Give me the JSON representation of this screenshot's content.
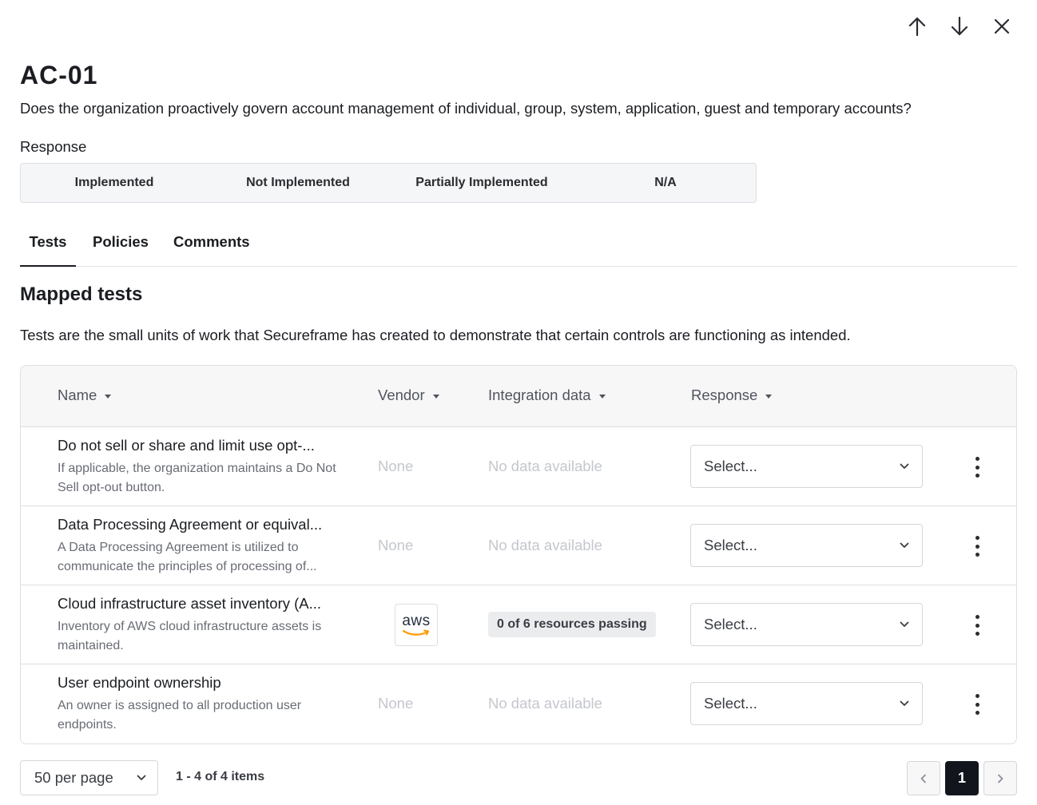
{
  "control": {
    "id": "AC-01",
    "question": "Does the organization proactively govern account management of individual, group, system, application, guest and temporary accounts?"
  },
  "response": {
    "label": "Response",
    "options": [
      "Implemented",
      "Not Implemented",
      "Partially Implemented",
      "N/A"
    ]
  },
  "tabs": [
    {
      "label": "Tests",
      "active": true
    },
    {
      "label": "Policies",
      "active": false
    },
    {
      "label": "Comments",
      "active": false
    }
  ],
  "mapped": {
    "title": "Mapped tests",
    "description": "Tests are the small units of work that Secureframe has created to demonstrate that certain controls are functioning as intended."
  },
  "table": {
    "columns": [
      "Name",
      "Vendor",
      "Integration data",
      "Response"
    ],
    "rows": [
      {
        "title": "Do not sell or share and limit use opt-...",
        "description": "If applicable, the organization maintains a Do Not Sell opt-out button.",
        "vendor": "None",
        "integration": "No data available",
        "response_placeholder": "Select..."
      },
      {
        "title": "Data Processing Agreement or equival...",
        "description": "A Data Processing Agreement is utilized to communicate the principles of processing of...",
        "vendor": "None",
        "integration": "No data available",
        "response_placeholder": "Select..."
      },
      {
        "title": "Cloud infrastructure asset inventory (A...",
        "description": "Inventory of AWS cloud infrastructure assets is maintained.",
        "vendor_logo": "aws",
        "integration_badge": "0 of 6 resources passing",
        "response_placeholder": "Select..."
      },
      {
        "title": "User endpoint ownership",
        "description": "An owner is assigned to all production user endpoints.",
        "vendor": "None",
        "integration": "No data available",
        "response_placeholder": "Select..."
      }
    ]
  },
  "pagination": {
    "per_page": "50 per page",
    "items_count": "1 - 4 of 4 items",
    "current_page": "1"
  },
  "icons": {
    "nav": [
      "arrow-up-icon",
      "arrow-down-icon",
      "close-icon"
    ],
    "row_menu": "kebab-menu-icon",
    "select": "chevron-down-icon"
  },
  "colors": {
    "aws_orange": "#ff9900",
    "active_page": "#12161c"
  }
}
